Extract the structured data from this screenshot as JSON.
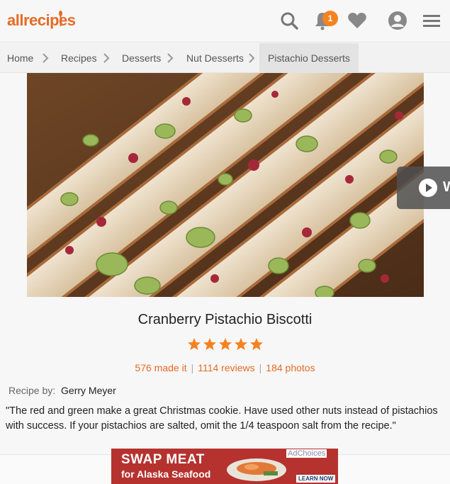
{
  "header": {
    "logo_text": "allrecipes",
    "notification_count": "1",
    "icons": [
      "search-icon",
      "bell-icon",
      "heart-icon",
      "user-icon",
      "menu-icon"
    ]
  },
  "breadcrumbs": [
    "Home",
    "Recipes",
    "Desserts",
    "Nut Desserts",
    "Pistachio Desserts"
  ],
  "video_button": {
    "label": "W",
    "icon": "play-icon"
  },
  "recipe": {
    "title": "Cranberry Pistachio Biscotti",
    "rating": 5,
    "made_it": "576 made it",
    "reviews": "1114 reviews",
    "photos": "184 photos",
    "by_label": "Recipe by:",
    "author": "Gerry Meyer",
    "description": "\"The red and green make a great Christmas cookie. Have used other nuts instead of pistachios with success. If your pistachios are salted, omit the 1/4 teaspoon salt from the recipe.\""
  },
  "ad": {
    "headline": "SWAP MEAT",
    "subline": "for Alaska Seafood",
    "adchoices": "AdChoices",
    "cta": "LEARN NOW"
  },
  "colors": {
    "brand": "#e56b25",
    "star": "#f58220"
  }
}
